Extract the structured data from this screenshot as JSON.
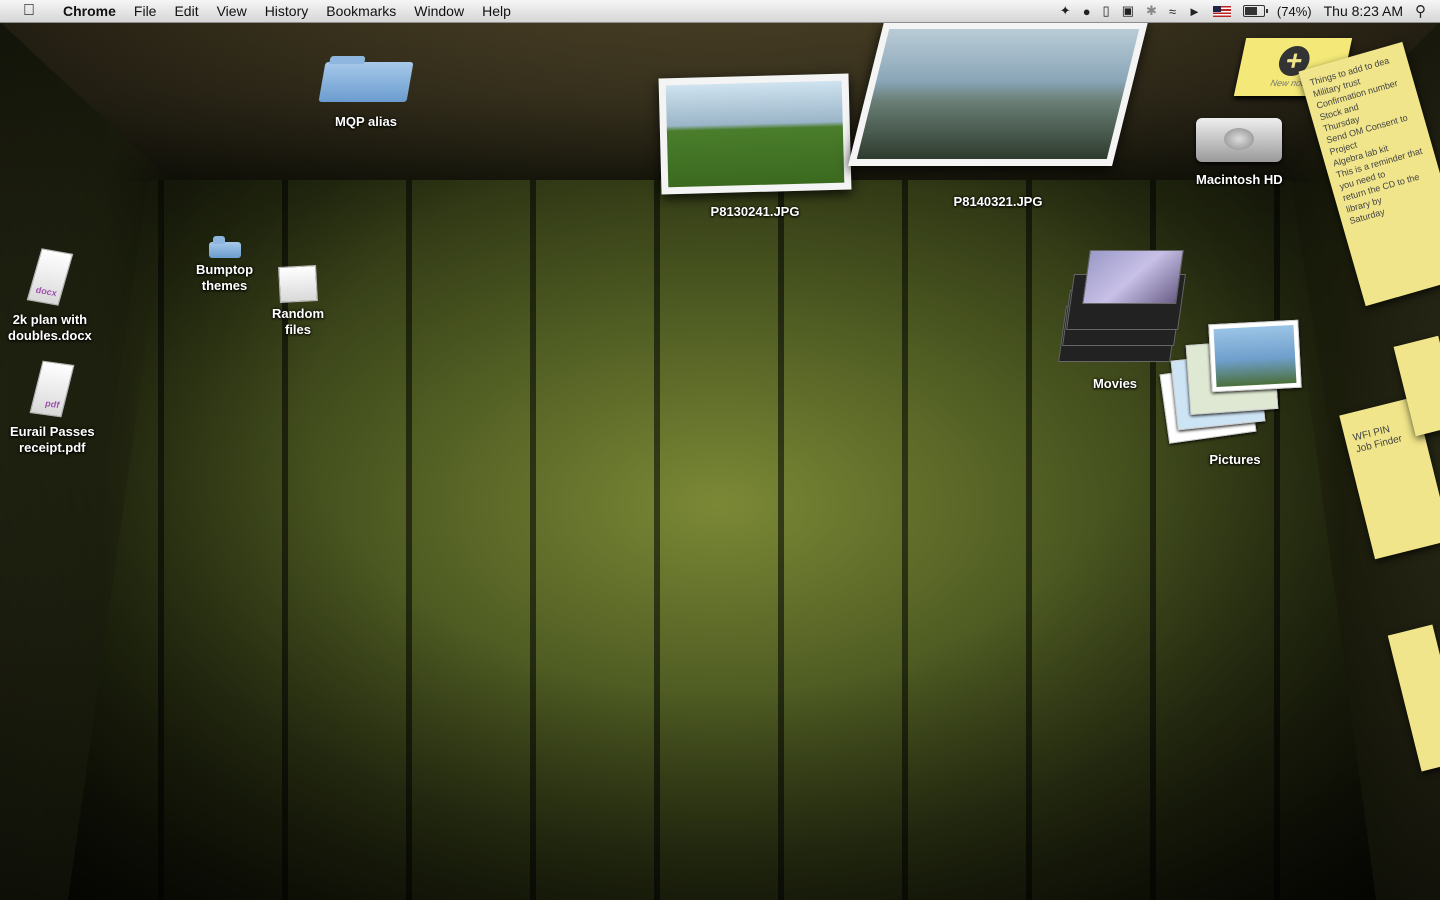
{
  "menubar": {
    "apple_icon": "apple-logo",
    "app_name": "Chrome",
    "menus": [
      "File",
      "Edit",
      "View",
      "History",
      "Bookmarks",
      "Window",
      "Help"
    ],
    "battery_percent": "(74%)",
    "clock": "Thu 8:23 AM",
    "tray_icons": [
      "butterfly-icon",
      "alien-icon",
      "note-icon",
      "share-icon",
      "bluetooth-icon",
      "wifi-icon",
      "volume-icon",
      "flag-icon",
      "battery-icon",
      "spotlight-icon"
    ]
  },
  "desktop": {
    "items": {
      "mqp_alias": "MQP alias",
      "photo1": "P8130241.JPG",
      "photo2": "P8140321.JPG",
      "new_note": "New note",
      "macintosh_hd": "Macintosh HD",
      "bumptop_themes": "Bumptop\nthemes",
      "random_files": "Random\nfiles",
      "doc_2k": "2k plan with\ndoubles.docx",
      "doc_eurail": "Eurail Passes\nreceipt.pdf",
      "movies": "Movies",
      "pictures": "Pictures"
    },
    "doc_types": {
      "docx": "docx",
      "pdf": "pdf"
    },
    "sticky_note_text": "Things to add to dea\nMilitary trust\nConfirmation number\nStock and\nThursday\nSend OM Consent to Project\nAlgebra lab kit\nThis is a reminder that you need to\nreturn the CD to the library by\nSaturday",
    "wall_note_text": "WFI PIN\nJob Finder"
  }
}
